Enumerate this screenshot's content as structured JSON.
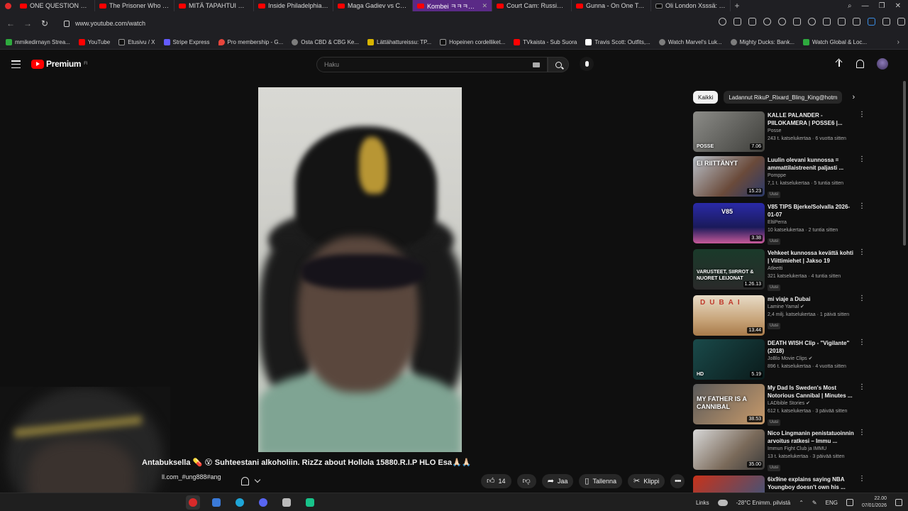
{
  "browser": {
    "tabs": [
      {
        "label": "ONE QUESTION GO IS BA",
        "active": false
      },
      {
        "label": "The Prisoner Who Made th",
        "active": false
      },
      {
        "label": "MITÄ TAPAHTUI HOTELLI",
        "active": false
      },
      {
        "label": "Inside Philadelphia's Real",
        "active": false
      },
      {
        "label": "Maga Gadiev vs Claudia",
        "active": false
      },
      {
        "label": "Kombei ㅋㅋㅋㅋㅊㅊ😂😂",
        "active": true
      },
      {
        "label": "Court Cam: Russian Man",
        "active": false
      },
      {
        "label": "Gunna - On One Tonight",
        "active": false
      },
      {
        "label": "Oli London Xsssä: \"Transg",
        "active": false
      }
    ],
    "url": "www.youtube.com/watch",
    "bookmarks": [
      {
        "label": "mmikedirnayn Strea...",
        "icon": "green"
      },
      {
        "label": "YouTube",
        "icon": "youtube"
      },
      {
        "label": "Etusivu / X",
        "icon": "x"
      },
      {
        "label": "Stripe Express",
        "icon": "stripe"
      },
      {
        "label": "Pro membership - G...",
        "icon": "maps"
      },
      {
        "label": "Osta CBD & CBG Ke...",
        "icon": "globe"
      },
      {
        "label": "Lättähattureissu: TP...",
        "icon": "yellow"
      },
      {
        "label": "Hopeinen cordelliket...",
        "icon": "nt"
      },
      {
        "label": "TVkaista - Sub Suora",
        "icon": "tv"
      },
      {
        "label": "Travis Scott: Outfits,...",
        "icon": "white"
      },
      {
        "label": "Watch Marvel's Luk...",
        "icon": "globe"
      },
      {
        "label": "Mighty Ducks: Bank...",
        "icon": "globe"
      },
      {
        "label": "Watch Global & Loc...",
        "icon": "green"
      }
    ]
  },
  "header": {
    "logo_text": "Premium",
    "logo_sup": "FI",
    "search_placeholder": "Haku"
  },
  "video": {
    "title": "Antabuksella 💊 😵 Suhteestani alkoholiin. RizZz about Hollola 15880.R.I.P HLO Esa🙏🏻🙏🏻",
    "channel": "ll.com_#ung888#ang",
    "likes": "14",
    "share_label": "Jaa",
    "save_label": "Tallenna",
    "clip_label": "Klippi"
  },
  "sidebar": {
    "chips": [
      "Kaikki",
      "Ladannut RikuP_Rixard_Bling_King@hotm"
    ],
    "recommendations": [
      {
        "title": "KALLE PALANDER - PIILOKAMERA | POSSE6 |...",
        "channel": "Posse",
        "meta": "243 t. katselukertaa · 6 vuotta sitten",
        "duration": "7.06",
        "thumb_text": "POSSE",
        "badge": ""
      },
      {
        "title": "Luulin olevani kunnossa = ammattilaistreenit paljasti ...",
        "channel": "Pomppe",
        "meta": "7,1 t. katselukertaa · 5 tuntia sitten",
        "duration": "15.23",
        "thumb_text": "EI RIITTÄNYT",
        "badge": "Uusi"
      },
      {
        "title": "V85 TIPS Bjerke/Solvalla 2026-01-07",
        "channel": "EltiPerra",
        "meta": "10 katselukertaa · 2 tuntia sitten",
        "duration": "3.38",
        "thumb_text": "V85",
        "badge": "Uusi"
      },
      {
        "title": "Vehkeet kunnossa kevättä kohti | Viittimiehet | Jakso 19",
        "channel": "Atleetti",
        "meta": "321 katselukertaa · 4 tuntia sitten",
        "duration": "1.26.13",
        "thumb_text": "VARUSTEET, SIIRROT & NUORET LEIJONAT",
        "badge": "Uusi"
      },
      {
        "title": "mi viaje a Dubai",
        "channel": "Lamine Yamal ✔",
        "meta": "2,4 milj. katselukertaa · 1 päivä sitten",
        "duration": "13.44",
        "thumb_text": "DUBAI",
        "badge": "Uusi"
      },
      {
        "title": "DEATH WISH Clip - \"Vigilante\" (2018)",
        "channel": "JoBlo Movie Clips ✔",
        "meta": "896 t. katselukertaa · 4 vuotta sitten",
        "duration": "5.19",
        "thumb_text": "HD",
        "badge": ""
      },
      {
        "title": "My Dad Is Sweden's Most Notorious Cannibal | Minutes ...",
        "channel": "LADbible Stories ✔",
        "meta": "612 t. katselukertaa · 3 päivää sitten",
        "duration": "38.53",
        "thumb_text": "MY FATHER IS A CANNIBAL",
        "badge": "Uusi"
      },
      {
        "title": "Nico Lingmanin penistatuoinnin arvoitus ratkesi – Immu ...",
        "channel": "Immun Fight Club ja IMMU",
        "meta": "13 t. katselukertaa · 3 päivää sitten",
        "duration": "35.00",
        "thumb_text": "",
        "badge": "Uusi"
      },
      {
        "title": "6ix9ine explains saying NBA Youngboy doesn't own his ...",
        "channel": "",
        "meta": "",
        "duration": "",
        "thumb_text": "",
        "badge": ""
      }
    ]
  },
  "taskbar": {
    "links_label": "Links",
    "weather": "-28°C  Enimm. pilvistä",
    "lang": "ENG",
    "time": "22.00",
    "date": "07/01/2026"
  },
  "colors": {
    "youtube_red": "#ff0000",
    "active_tab": "#5a2a86",
    "background": "#0f0f0f"
  }
}
